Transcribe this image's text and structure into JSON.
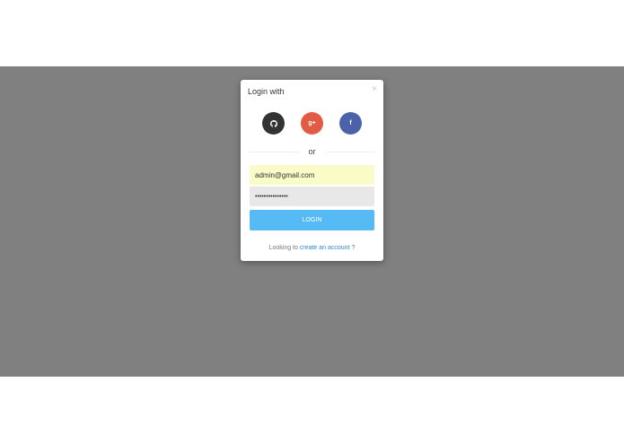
{
  "modal": {
    "title": "Login with",
    "close_glyph": "×",
    "social": [
      {
        "name": "github",
        "glyph": "◉",
        "icon": "github-icon",
        "color": "#333333"
      },
      {
        "name": "google",
        "glyph": "g+",
        "icon": "google-plus-icon",
        "color": "#e25b45"
      },
      {
        "name": "facebook",
        "glyph": "f",
        "icon": "facebook-icon",
        "color": "#4b62a9"
      }
    ],
    "divider_text": "or",
    "email_value": "admin@gmail.com",
    "password_value": "•••••••••••••••",
    "login_label": "LOGIN",
    "footer_prefix": "Looking to ",
    "footer_link": "create an account",
    "footer_suffix": " ?"
  },
  "colors": {
    "backdrop": "#808080",
    "login_button": "#56baf5",
    "email_field": "#fafcc8",
    "password_field": "#e8e8e8",
    "link": "#2d8bd6"
  }
}
